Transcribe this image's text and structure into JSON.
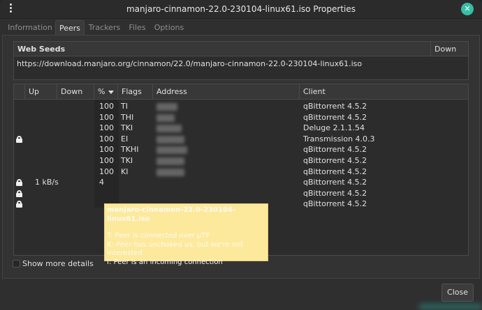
{
  "window": {
    "title": "manjaro-cinnamon-22.0-230104-linux61.iso Properties"
  },
  "tabs": [
    {
      "label": "Information",
      "active": false
    },
    {
      "label": "Peers",
      "active": true
    },
    {
      "label": "Trackers",
      "active": false
    },
    {
      "label": "Files",
      "active": false
    },
    {
      "label": "Options",
      "active": false
    }
  ],
  "web_seeds": {
    "header_seeds": "Web Seeds",
    "header_down": "Down",
    "url": "https://download.manjaro.org/cinnamon/22.0/manjaro-cinnamon-22.0-230104-linux61.iso"
  },
  "peers": {
    "columns": {
      "up": "Up",
      "down": "Down",
      "pct": "%",
      "flags": "Flags",
      "address": "Address",
      "client": "Client"
    },
    "sorted_by": "%",
    "rows": [
      {
        "encrypted": false,
        "down": "",
        "pct": "100",
        "flags": "TI",
        "client": "qBittorrent 4.5.2"
      },
      {
        "encrypted": false,
        "down": "",
        "pct": "100",
        "flags": "THI",
        "client": "qBittorrent 4.5.2"
      },
      {
        "encrypted": false,
        "down": "",
        "pct": "100",
        "flags": "TKI",
        "client": "Deluge 2.1.1.54"
      },
      {
        "encrypted": true,
        "down": "",
        "pct": "100",
        "flags": "EI",
        "client": "Transmission 4.0.3"
      },
      {
        "encrypted": false,
        "down": "",
        "pct": "100",
        "flags": "TKHI",
        "client": "qBittorrent 4.5.2"
      },
      {
        "encrypted": false,
        "down": "",
        "pct": "100",
        "flags": "TKI",
        "client": "qBittorrent 4.5.2"
      },
      {
        "encrypted": false,
        "down": "",
        "pct": "100",
        "flags": "KI",
        "client": "qBittorrent 4.5.2"
      },
      {
        "encrypted": true,
        "down": "1 kB/s",
        "pct": "4",
        "flags": "",
        "client": "qBittorrent 4.5.2"
      },
      {
        "encrypted": true,
        "down": "",
        "pct": "",
        "flags": "",
        "client": "qBittorrent 4.5.2"
      },
      {
        "encrypted": true,
        "down": "",
        "pct": "",
        "flags": "",
        "client": "qBittorrent 4.5.2"
      }
    ]
  },
  "tooltip": {
    "title": "manjaro-cinnamon-22.0-230104-linux61.iso",
    "lines": [
      "T: Peer is connected over µTP",
      "K: Peer has unchoked us, but we're not interested",
      "I: Peer is an incoming connection"
    ]
  },
  "show_more_details": {
    "label": "Show more details",
    "checked": false
  },
  "close_button": {
    "label": "Close"
  },
  "colors": {
    "accent": "#35bfa4",
    "tooltip_bg": "#fde99b",
    "window_bg": "#2f2f2f"
  }
}
